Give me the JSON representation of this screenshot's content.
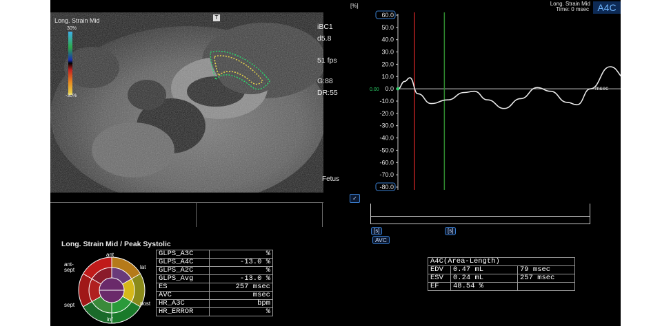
{
  "header": {
    "strain_title": "Long. Strain Mid",
    "time": "Time: 0 msec",
    "view": "A4C"
  },
  "image_panel": {
    "mode_label": "Long. Strain Mid",
    "probe_marker": "T",
    "scale_top": "30%",
    "scale_bottom": "-30%",
    "settings": [
      "iBC1",
      "d5.8",
      "51 fps",
      "G:88",
      "DR:55"
    ],
    "preset": "Fetus"
  },
  "strain_chart": {
    "unit_label": "[%]",
    "x_unit": "msec",
    "marker_value": "0.00",
    "bottom_left_button": "✓",
    "markers": [
      "AVC"
    ],
    "bottom_tags": [
      "[s]",
      "[s]"
    ]
  },
  "chart_data": {
    "type": "line",
    "ylabel": "[%]",
    "ylim": [
      -80,
      60
    ],
    "yticks": [
      "60.0",
      "50.0",
      "40.0",
      "30.0",
      "20.0",
      "10.0",
      "0.0",
      "-10.0",
      "-20.0",
      "-30.0",
      "-40.0",
      "-50.0",
      "-60.0",
      "-70.0",
      "-80.0"
    ],
    "xlabel": "msec",
    "series": [
      {
        "color": "#e8e8e8",
        "points": [
          [
            0,
            0
          ],
          [
            10,
            6
          ],
          [
            18,
            9
          ],
          [
            30,
            -4
          ],
          [
            50,
            -12
          ],
          [
            75,
            -9
          ],
          [
            100,
            -3
          ],
          [
            115,
            -2
          ],
          [
            135,
            -9
          ],
          [
            160,
            -16
          ],
          [
            185,
            -8
          ],
          [
            210,
            1
          ],
          [
            230,
            -2
          ],
          [
            255,
            -11
          ],
          [
            270,
            -13
          ],
          [
            290,
            0
          ],
          [
            320,
            18
          ],
          [
            345,
            8
          ],
          [
            370,
            -1
          ]
        ]
      }
    ],
    "vlines": [
      {
        "x": 25,
        "color": "#b02020"
      },
      {
        "x": 70,
        "color": "#2f8a2f"
      },
      {
        "x": 370,
        "color": "#e8e8e8"
      }
    ]
  },
  "bullseye": {
    "title": "Long. Strain Mid / Peak Systolic",
    "labels": {
      "ant": "ant",
      "ant_sept": "ant-\nsept",
      "lat": "lat",
      "sept": "sept",
      "post": "post",
      "inf": "inf"
    }
  },
  "glps_table": {
    "rows": [
      {
        "label": "GLPS_A3C",
        "value": "%"
      },
      {
        "label": "GLPS_A4C",
        "value": "-13.0 %"
      },
      {
        "label": "GLPS_A2C",
        "value": "%"
      },
      {
        "label": "GLPS_Avg",
        "value": "-13.0 %"
      },
      {
        "label": "ES",
        "value": "257 msec"
      },
      {
        "label": "AVC",
        "value": "msec"
      },
      {
        "label": "HR_A3C",
        "value": "bpm"
      },
      {
        "label": "HR_ERROR",
        "value": "%"
      }
    ]
  },
  "volume_table": {
    "title": "A4C(Area-Length)",
    "rows": [
      {
        "label": "EDV",
        "value": "0.47 mL",
        "time": "79 msec"
      },
      {
        "label": "ESV",
        "value": "0.24 mL",
        "time": "257 msec"
      },
      {
        "label": "EF",
        "value": "48.54 %",
        "time": ""
      }
    ]
  }
}
